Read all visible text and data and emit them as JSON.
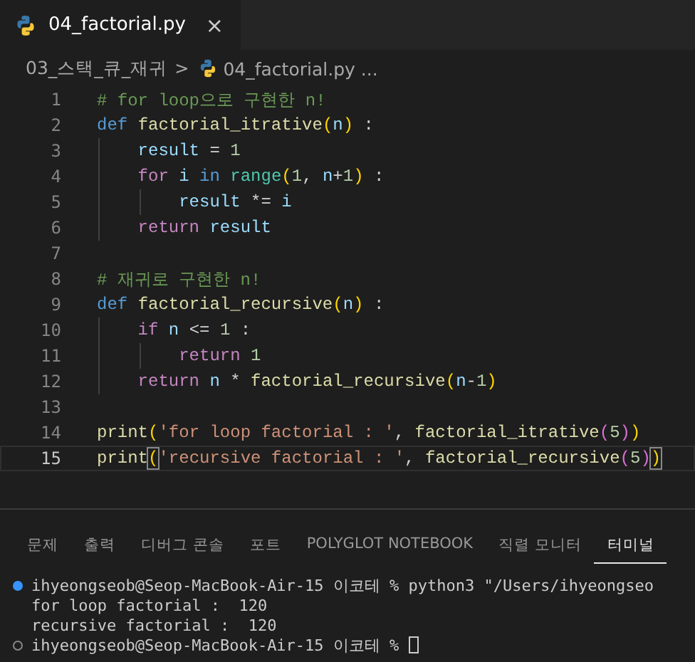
{
  "editor_tabs": [
    {
      "label": "04_factorial.py",
      "selected": true,
      "close": "×"
    }
  ],
  "breadcrumb": {
    "folder": "03_스택_큐_재귀",
    "separator": ">",
    "file": "04_factorial.py",
    "trail": "..."
  },
  "code_lines": [
    {
      "number": "1",
      "active": false,
      "tokens": [
        {
          "t": "# for loop으로 구현한 n!",
          "kind": "comment"
        }
      ]
    },
    {
      "number": "2",
      "active": false,
      "tokens": [
        {
          "t": "def ",
          "kind": "keyword"
        },
        {
          "t": "factorial_itrative",
          "kind": "func"
        },
        {
          "t": "(",
          "kind": "paren"
        },
        {
          "t": "n",
          "kind": "var"
        },
        {
          "t": ")",
          "kind": "paren"
        },
        {
          "t": " :",
          "kind": "plain"
        }
      ]
    },
    {
      "number": "3",
      "active": false,
      "tokens": [
        {
          "t": "    result",
          "kind": "var"
        },
        {
          "t": " = ",
          "kind": "plain"
        },
        {
          "t": "1",
          "kind": "number"
        }
      ]
    },
    {
      "number": "4",
      "active": false,
      "tokens": [
        {
          "t": "    for",
          "kind": "control"
        },
        {
          "t": " i ",
          "kind": "var"
        },
        {
          "t": "in ",
          "kind": "keyword"
        },
        {
          "t": "range",
          "kind": "builtin"
        },
        {
          "t": "(",
          "kind": "paren"
        },
        {
          "t": "1",
          "kind": "number"
        },
        {
          "t": ", ",
          "kind": "plain"
        },
        {
          "t": "n",
          "kind": "var"
        },
        {
          "t": "+",
          "kind": "plain"
        },
        {
          "t": "1",
          "kind": "number"
        },
        {
          "t": ")",
          "kind": "paren"
        },
        {
          "t": " :",
          "kind": "plain"
        }
      ]
    },
    {
      "number": "5",
      "active": false,
      "tokens": [
        {
          "t": "        result",
          "kind": "var"
        },
        {
          "t": " *= ",
          "kind": "plain"
        },
        {
          "t": "i",
          "kind": "var"
        }
      ]
    },
    {
      "number": "6",
      "active": false,
      "tokens": [
        {
          "t": "    return",
          "kind": "control"
        },
        {
          "t": " result",
          "kind": "var"
        }
      ]
    },
    {
      "number": "7",
      "active": false
    },
    {
      "number": "8",
      "active": false,
      "tokens": [
        {
          "t": "# 재귀로 구현한 n!",
          "kind": "comment"
        }
      ]
    },
    {
      "number": "9",
      "active": false,
      "tokens": [
        {
          "t": "def ",
          "kind": "keyword"
        },
        {
          "t": "factorial_recursive",
          "kind": "func"
        },
        {
          "t": "(",
          "kind": "paren"
        },
        {
          "t": "n",
          "kind": "var"
        },
        {
          "t": ")",
          "kind": "paren"
        },
        {
          "t": " :",
          "kind": "plain"
        }
      ]
    },
    {
      "number": "10",
      "active": false,
      "tokens": [
        {
          "t": "    if",
          "kind": "control"
        },
        {
          "t": " n",
          "kind": "var"
        },
        {
          "t": " <= ",
          "kind": "plain"
        },
        {
          "t": "1",
          "kind": "number"
        },
        {
          "t": " :",
          "kind": "plain"
        }
      ]
    },
    {
      "number": "11",
      "active": false,
      "tokens": [
        {
          "t": "        return ",
          "kind": "control"
        },
        {
          "t": "1",
          "kind": "number"
        }
      ]
    },
    {
      "number": "12",
      "active": false,
      "tokens": [
        {
          "t": "    return",
          "kind": "control"
        },
        {
          "t": " n",
          "kind": "var"
        },
        {
          "t": " * ",
          "kind": "plain"
        },
        {
          "t": "factorial_recursive",
          "kind": "func"
        },
        {
          "t": "(",
          "kind": "paren"
        },
        {
          "t": "n",
          "kind": "var"
        },
        {
          "t": "-",
          "kind": "plain"
        },
        {
          "t": "1",
          "kind": "number"
        },
        {
          "t": ")",
          "kind": "paren"
        }
      ]
    },
    {
      "number": "13",
      "active": false
    },
    {
      "number": "14",
      "active": false,
      "tokens": [
        {
          "t": "print",
          "kind": "func"
        },
        {
          "t": "(",
          "kind": "paren"
        },
        {
          "t": "'for loop factorial : '",
          "kind": "string"
        },
        {
          "t": ", ",
          "kind": "plain"
        },
        {
          "t": "factorial_itrative",
          "kind": "func"
        },
        {
          "t": "(",
          "kind": "paren2"
        },
        {
          "t": "5",
          "kind": "number"
        },
        {
          "t": ")",
          "kind": "paren2"
        },
        {
          "t": ")",
          "kind": "paren"
        }
      ]
    },
    {
      "number": "15",
      "active": true,
      "tokens": [
        {
          "t": "print",
          "kind": "func"
        },
        {
          "t": "(",
          "kind": "paren-match"
        },
        {
          "t": "'recursive factorial : '",
          "kind": "string"
        },
        {
          "t": ", ",
          "kind": "plain"
        },
        {
          "t": "factorial_recursive",
          "kind": "func"
        },
        {
          "t": "(",
          "kind": "paren2"
        },
        {
          "t": "5",
          "kind": "number"
        },
        {
          "t": ")",
          "kind": "paren2"
        },
        {
          "t": ")",
          "kind": "paren-match"
        }
      ]
    }
  ],
  "panel_tabs": [
    {
      "label": "문제",
      "selected": false
    },
    {
      "label": "출력",
      "selected": false
    },
    {
      "label": "디버그 콘솔",
      "selected": false
    },
    {
      "label": "포트",
      "selected": false
    },
    {
      "label": "POLYGLOT NOTEBOOK",
      "selected": false
    },
    {
      "label": "직렬 모니터",
      "selected": false
    },
    {
      "label": "터미널",
      "selected": true
    }
  ],
  "terminal_lines": [
    {
      "kind": "prompt-done",
      "text": "ihyeongseob@Seop-MacBook-Air-15 이코테 % python3 \"/Users/ihyeongseo"
    },
    {
      "kind": "output",
      "text": "for loop factorial :  120"
    },
    {
      "kind": "output",
      "text": "recursive factorial :  120"
    },
    {
      "kind": "prompt",
      "text": "ihyeongseob@Seop-MacBook-Air-15 이코테 %",
      "cursor": true
    }
  ]
}
